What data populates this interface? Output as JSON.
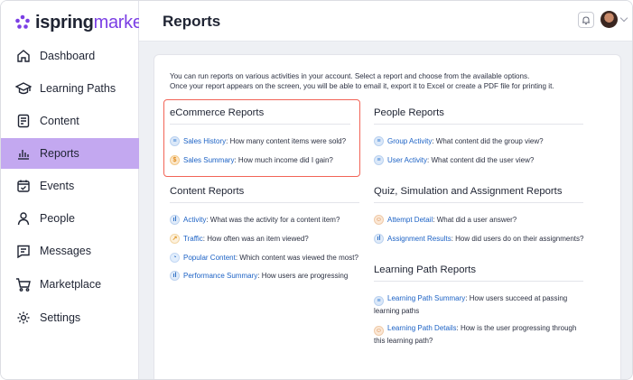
{
  "brand": {
    "part1": "ispring",
    "part2": "market"
  },
  "sidebar": {
    "items": [
      {
        "label": "Dashboard",
        "icon": "home-icon"
      },
      {
        "label": "Learning Paths",
        "icon": "graduation-cap-icon"
      },
      {
        "label": "Content",
        "icon": "document-icon"
      },
      {
        "label": "Reports",
        "icon": "bar-chart-icon",
        "active": true
      },
      {
        "label": "Events",
        "icon": "calendar-check-icon"
      },
      {
        "label": "People",
        "icon": "person-icon"
      },
      {
        "label": "Messages",
        "icon": "message-icon"
      },
      {
        "label": "Marketplace",
        "icon": "cart-icon"
      },
      {
        "label": "Settings",
        "icon": "gear-icon"
      }
    ]
  },
  "header": {
    "title": "Reports"
  },
  "intro": {
    "line1": "You can run reports on various activities in your account. Select a report and choose from the available options.",
    "line2": "Once your report appears on the screen, you will be able to email it, export it to Excel or create a PDF file for printing it."
  },
  "sections": {
    "ecommerce": {
      "title": "eCommerce Reports",
      "reports": [
        {
          "link": "Sales History",
          "desc": ": How many content items were sold?"
        },
        {
          "link": "Sales Summary",
          "desc": ": How much income did I gain?"
        }
      ]
    },
    "people": {
      "title": "People Reports",
      "reports": [
        {
          "link": "Group Activity",
          "desc": ": What content did the group view?"
        },
        {
          "link": "User Activity",
          "desc": ": What content did the user view?"
        }
      ]
    },
    "content": {
      "title": "Content Reports",
      "reports": [
        {
          "link": "Activity",
          "desc": ": What was the activity for a content item?"
        },
        {
          "link": "Traffic",
          "desc": ": How often was an item viewed?"
        },
        {
          "link": "Popular Content",
          "desc": ": Which content was viewed the most?"
        },
        {
          "link": "Performance Summary",
          "desc": ": How users are progressing"
        }
      ]
    },
    "quiz": {
      "title": "Quiz, Simulation and Assignment Reports",
      "reports": [
        {
          "link": "Attempt Detail",
          "desc": ": What did a user answer?"
        },
        {
          "link": "Assignment Results",
          "desc": ": How did users do on their assignments?"
        }
      ]
    },
    "learning_path": {
      "title": "Learning Path Reports",
      "reports": [
        {
          "link": "Learning Path Summary",
          "desc": ": How users succeed at passing learning paths"
        },
        {
          "link": "Learning Path Details",
          "desc": ": How is the user progressing through this learning path?"
        }
      ]
    }
  },
  "colors": {
    "accent": "#7b3fe4",
    "active_nav": "#c3a8f0",
    "link": "#1c62c5",
    "highlight_border": "#f26457"
  }
}
